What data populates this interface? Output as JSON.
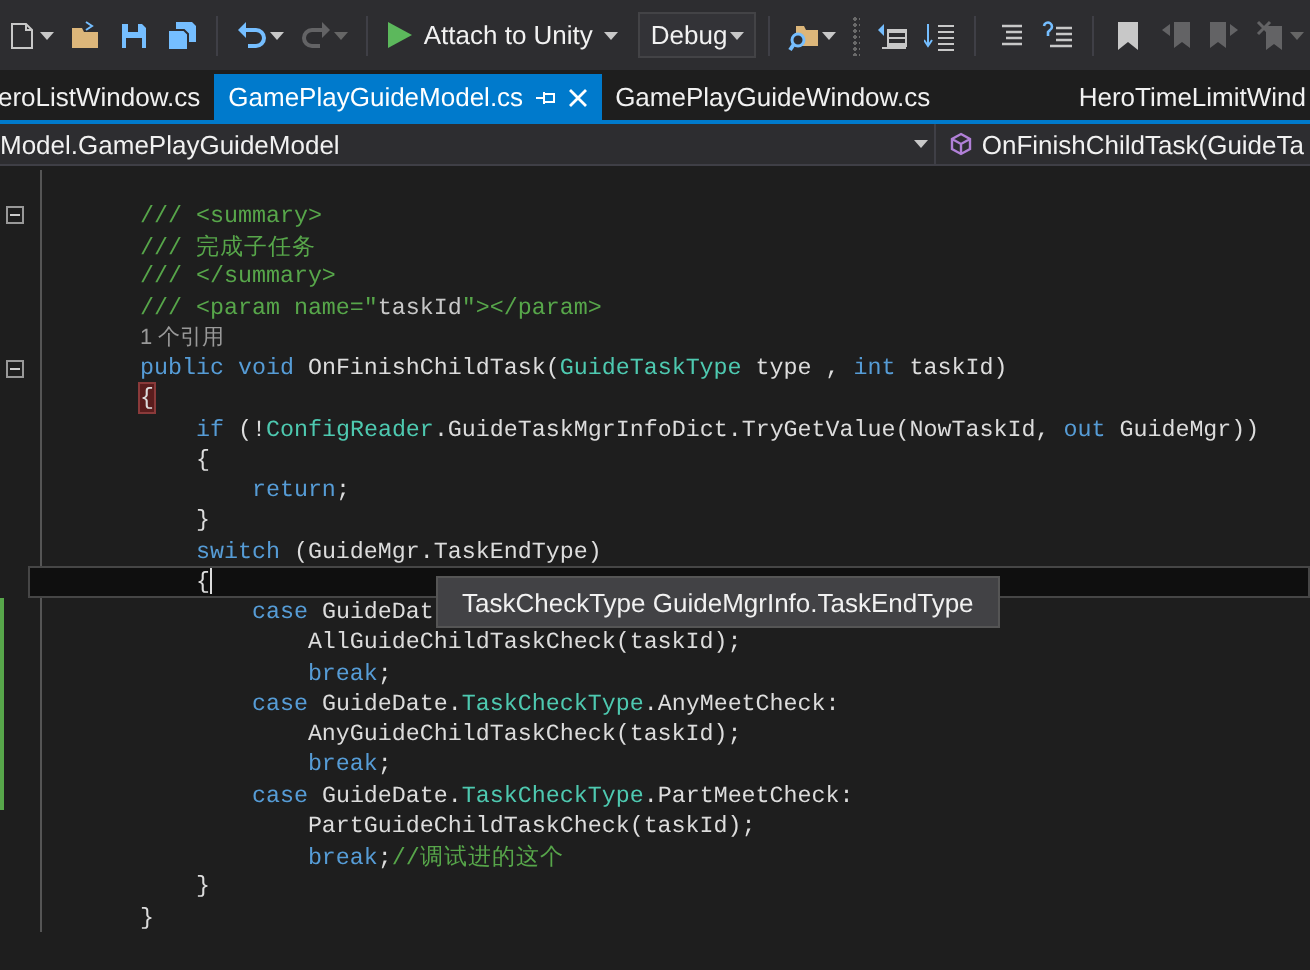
{
  "toolbar": {
    "items": [
      {
        "kind": "new-item",
        "disabled": false,
        "menu": true
      },
      {
        "kind": "open",
        "disabled": false,
        "menu": false
      },
      {
        "kind": "save",
        "disabled": false,
        "menu": false
      },
      {
        "kind": "save-all",
        "disabled": false,
        "menu": false
      },
      {
        "kind": "separator"
      },
      {
        "kind": "undo",
        "disabled": false,
        "menu": true
      },
      {
        "kind": "redo",
        "disabled": true,
        "menu": true
      },
      {
        "kind": "separator"
      },
      {
        "kind": "run",
        "label": "Attach to Unity",
        "disabled": false,
        "menu": true
      },
      {
        "kind": "config",
        "value": "Debug"
      },
      {
        "kind": "separator"
      },
      {
        "kind": "find",
        "disabled": false,
        "menu": true
      },
      {
        "kind": "grip"
      },
      {
        "kind": "outdent",
        "disabled": false,
        "menu": false
      },
      {
        "kind": "indent",
        "disabled": false,
        "menu": false
      },
      {
        "kind": "separator"
      },
      {
        "kind": "comment",
        "disabled": false,
        "menu": false
      },
      {
        "kind": "uncomment",
        "disabled": false,
        "menu": false
      },
      {
        "kind": "separator"
      },
      {
        "kind": "bookmark",
        "disabled": false,
        "menu": false
      },
      {
        "kind": "prev-bookmark",
        "disabled": true,
        "menu": false
      },
      {
        "kind": "next-bookmark",
        "disabled": true,
        "menu": false
      },
      {
        "kind": "clear-bookmarks",
        "disabled": true,
        "menu": true
      }
    ]
  },
  "tabs": [
    {
      "label": "eroListWindow.cs",
      "selected": false
    },
    {
      "label": "GamePlayGuideModel.cs",
      "selected": true
    },
    {
      "label": "GamePlayGuideWindow.cs",
      "selected": false
    },
    {
      "label": "HeroTimeLimitWind",
      "selected": false
    }
  ],
  "navigation_bar": {
    "type_dropdown": "Model.GamePlayGuideModel",
    "member_dropdown": "OnFinishChildTask(GuideTa"
  },
  "editor": {
    "lines": [
      {
        "fold_toggle": true,
        "changed": false,
        "current": false,
        "tokens": [
          {
            "kind": "comment",
            "text": "/// <summary>"
          }
        ]
      },
      {
        "fold_toggle": false,
        "changed": false,
        "current": false,
        "tokens": [
          {
            "kind": "comment",
            "text": "/// 完成子任务"
          }
        ]
      },
      {
        "fold_toggle": false,
        "changed": false,
        "current": false,
        "tokens": [
          {
            "kind": "comment",
            "text": "/// </summary>"
          }
        ]
      },
      {
        "fold_toggle": false,
        "changed": false,
        "current": false,
        "tokens": [
          {
            "kind": "comment",
            "text": "/// <param name=\""
          },
          {
            "kind": "doc-text",
            "text": "taskId"
          },
          {
            "kind": "comment",
            "text": "\"></param>"
          }
        ]
      },
      {
        "fold_toggle": false,
        "changed": false,
        "current": false,
        "tokens": [
          {
            "kind": "codelens",
            "text": "1 个引用"
          }
        ]
      },
      {
        "fold_toggle": true,
        "changed": false,
        "current": false,
        "tokens": [
          {
            "kind": "keyword",
            "text": "public void"
          },
          {
            "kind": "plain",
            "text": " OnFinishChildTask("
          },
          {
            "kind": "type",
            "text": "GuideTaskType"
          },
          {
            "kind": "plain",
            "text": " type , "
          },
          {
            "kind": "keyword",
            "text": "int"
          },
          {
            "kind": "plain",
            "text": " taskId)"
          }
        ]
      },
      {
        "fold_toggle": false,
        "changed": false,
        "current": false,
        "tokens": [
          {
            "kind": "brace-match",
            "text": "{"
          }
        ]
      },
      {
        "fold_toggle": false,
        "changed": false,
        "current": false,
        "tokens": [
          {
            "kind": "keyword",
            "text": "    if"
          },
          {
            "kind": "plain",
            "text": " (!"
          },
          {
            "kind": "type",
            "text": "ConfigReader"
          },
          {
            "kind": "plain",
            "text": ".GuideTaskMgrInfoDict.TryGetValue(NowTaskId, "
          },
          {
            "kind": "keyword",
            "text": "out"
          },
          {
            "kind": "plain",
            "text": " GuideMgr))"
          }
        ]
      },
      {
        "fold_toggle": false,
        "changed": false,
        "current": false,
        "tokens": [
          {
            "kind": "plain",
            "text": "    {"
          }
        ]
      },
      {
        "fold_toggle": false,
        "changed": false,
        "current": false,
        "tokens": [
          {
            "kind": "keyword",
            "text": "        return"
          },
          {
            "kind": "plain",
            "text": ";"
          }
        ]
      },
      {
        "fold_toggle": false,
        "changed": false,
        "current": false,
        "tokens": [
          {
            "kind": "plain",
            "text": "    }"
          }
        ]
      },
      {
        "fold_toggle": false,
        "changed": false,
        "current": false,
        "tokens": [
          {
            "kind": "keyword",
            "text": "    switch"
          },
          {
            "kind": "plain",
            "text": " (GuideMgr.TaskEndType)"
          }
        ]
      },
      {
        "fold_toggle": false,
        "changed": false,
        "current": true,
        "tokens": [
          {
            "kind": "plain",
            "text": "    {"
          }
        ]
      },
      {
        "fold_toggle": false,
        "changed": true,
        "current": false,
        "tokens": [
          {
            "kind": "keyword",
            "text": "        case"
          },
          {
            "kind": "plain",
            "text": " GuideDat"
          }
        ]
      },
      {
        "fold_toggle": false,
        "changed": true,
        "current": false,
        "tokens": [
          {
            "kind": "plain",
            "text": "            AllGuideChildTaskCheck(taskId);"
          }
        ]
      },
      {
        "fold_toggle": false,
        "changed": true,
        "current": false,
        "tokens": [
          {
            "kind": "keyword",
            "text": "            break"
          },
          {
            "kind": "plain",
            "text": ";"
          }
        ]
      },
      {
        "fold_toggle": false,
        "changed": true,
        "current": false,
        "tokens": [
          {
            "kind": "keyword",
            "text": "        case"
          },
          {
            "kind": "plain",
            "text": " GuideDate."
          },
          {
            "kind": "type",
            "text": "TaskCheckType"
          },
          {
            "kind": "plain",
            "text": ".AnyMeetCheck:"
          }
        ]
      },
      {
        "fold_toggle": false,
        "changed": true,
        "current": false,
        "tokens": [
          {
            "kind": "plain",
            "text": "            AnyGuideChildTaskCheck(taskId);"
          }
        ]
      },
      {
        "fold_toggle": false,
        "changed": true,
        "current": false,
        "tokens": [
          {
            "kind": "keyword",
            "text": "            break"
          },
          {
            "kind": "plain",
            "text": ";"
          }
        ]
      },
      {
        "fold_toggle": false,
        "changed": true,
        "current": false,
        "tokens": [
          {
            "kind": "keyword",
            "text": "        case"
          },
          {
            "kind": "plain",
            "text": " GuideDate."
          },
          {
            "kind": "type",
            "text": "TaskCheckType"
          },
          {
            "kind": "plain",
            "text": ".PartMeetCheck:"
          }
        ]
      },
      {
        "fold_toggle": false,
        "changed": false,
        "current": false,
        "tokens": [
          {
            "kind": "plain",
            "text": "            PartGuideChildTaskCheck(taskId);"
          }
        ]
      },
      {
        "fold_toggle": false,
        "changed": false,
        "current": false,
        "tokens": [
          {
            "kind": "keyword",
            "text": "            break"
          },
          {
            "kind": "plain",
            "text": ";"
          },
          {
            "kind": "comment",
            "text": "//调试进的这个"
          }
        ]
      },
      {
        "fold_toggle": false,
        "changed": false,
        "current": false,
        "tokens": [
          {
            "kind": "plain",
            "text": "    }"
          }
        ]
      },
      {
        "fold_toggle": false,
        "changed": false,
        "current": false,
        "tokens": [
          {
            "kind": "plain",
            "text": "}"
          }
        ]
      }
    ],
    "tooltip": "TaskCheckType GuideMgrInfo.TaskEndType"
  }
}
